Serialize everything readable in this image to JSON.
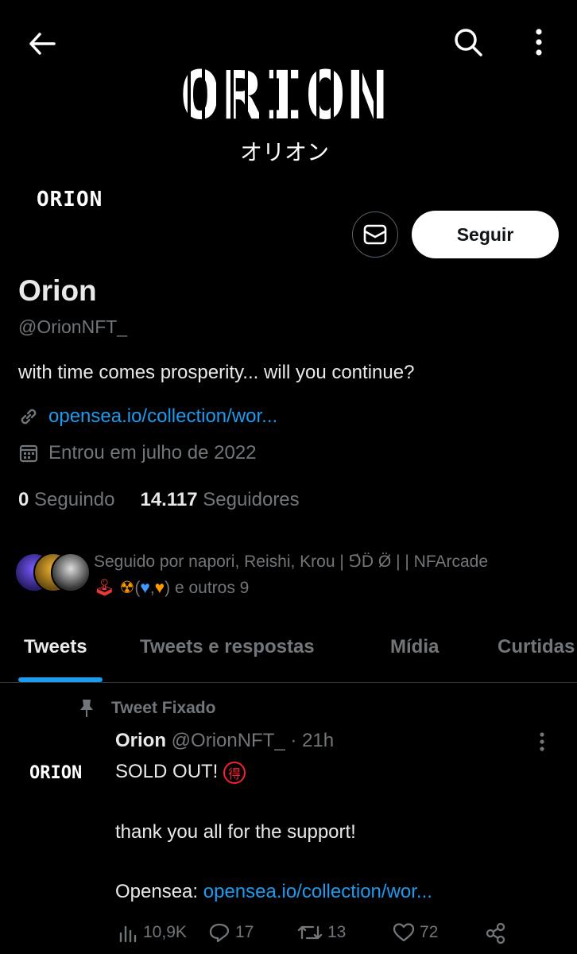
{
  "banner": {
    "logo_text": "ORION",
    "kana": "オリオン"
  },
  "avatar": {
    "logo_text": "ORION"
  },
  "actions": {
    "follow_label": "Seguir"
  },
  "profile": {
    "name": "Orion",
    "handle": "@OrionNFT_",
    "bio": "with time comes prosperity... will you continue?",
    "link": "opensea.io/collection/wor...",
    "joined": "Entrou em julho de 2022",
    "following_count": "0",
    "following_label": "Seguindo",
    "followers_count": "14.117",
    "followers_label": "Seguidores"
  },
  "followed_by": {
    "line1": "Seguido por napori, Reishi, Krou | ⅁̇D̈ Ø̈ | | NFArcade",
    "line2_suffix": ") e outros 9"
  },
  "tabs": [
    "Tweets",
    "Tweets e respostas",
    "Mídia",
    "Curtidas"
  ],
  "pinned": {
    "label": "Tweet Fixado",
    "avatar_text": "ORION",
    "author_name": "Orion",
    "author_handle": "@OrionNFT_",
    "time": "· 21h",
    "line1": "SOLD OUT!",
    "badge": "得",
    "line2": "thank you all for the support!",
    "line3_prefix": "Opensea:",
    "line3_link": "opensea.io/collection/wor...",
    "stats": {
      "views": "10,9K",
      "replies": "17",
      "retweets": "13",
      "likes": "72"
    }
  },
  "colors": {
    "accent": "#1d9bf0",
    "muted": "#71767b",
    "text": "#e7e9ea",
    "background": "#000000"
  },
  "icons": [
    "back-arrow-icon",
    "search-icon",
    "more-vertical-icon",
    "mail-icon",
    "link-icon",
    "calendar-icon",
    "pin-icon",
    "views-icon",
    "reply-icon",
    "retweet-icon",
    "like-icon",
    "share-icon"
  ]
}
